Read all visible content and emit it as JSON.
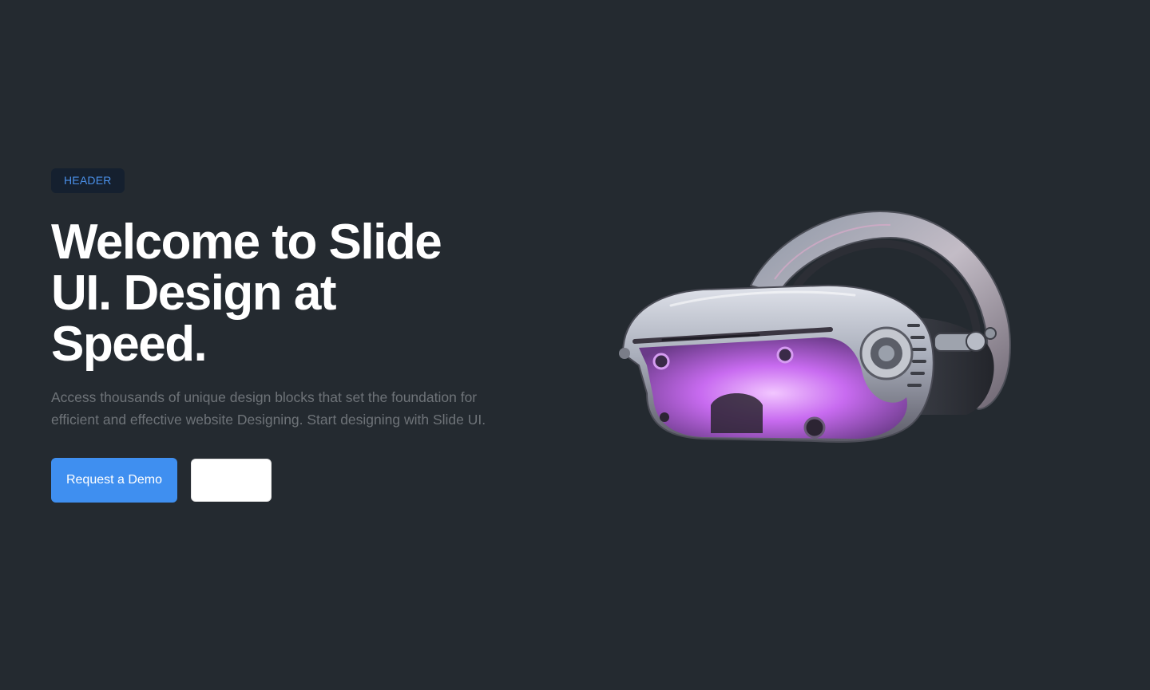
{
  "hero": {
    "badge": "HEADER",
    "title": "Welcome to Slide UI. Design at Speed.",
    "description": "Access thousands of unique design blocks that set the foundation for efficient and effective website Designing. Start designing with Slide UI.",
    "primary_button": "Request a Demo",
    "secondary_button": "",
    "image": "vr-headset-icon"
  },
  "colors": {
    "background": "#242a30",
    "accent": "#3f8ff0",
    "badge_text": "#4a8fe8",
    "badge_bg": "#15202f",
    "headset_glow": "#c86bf0"
  }
}
